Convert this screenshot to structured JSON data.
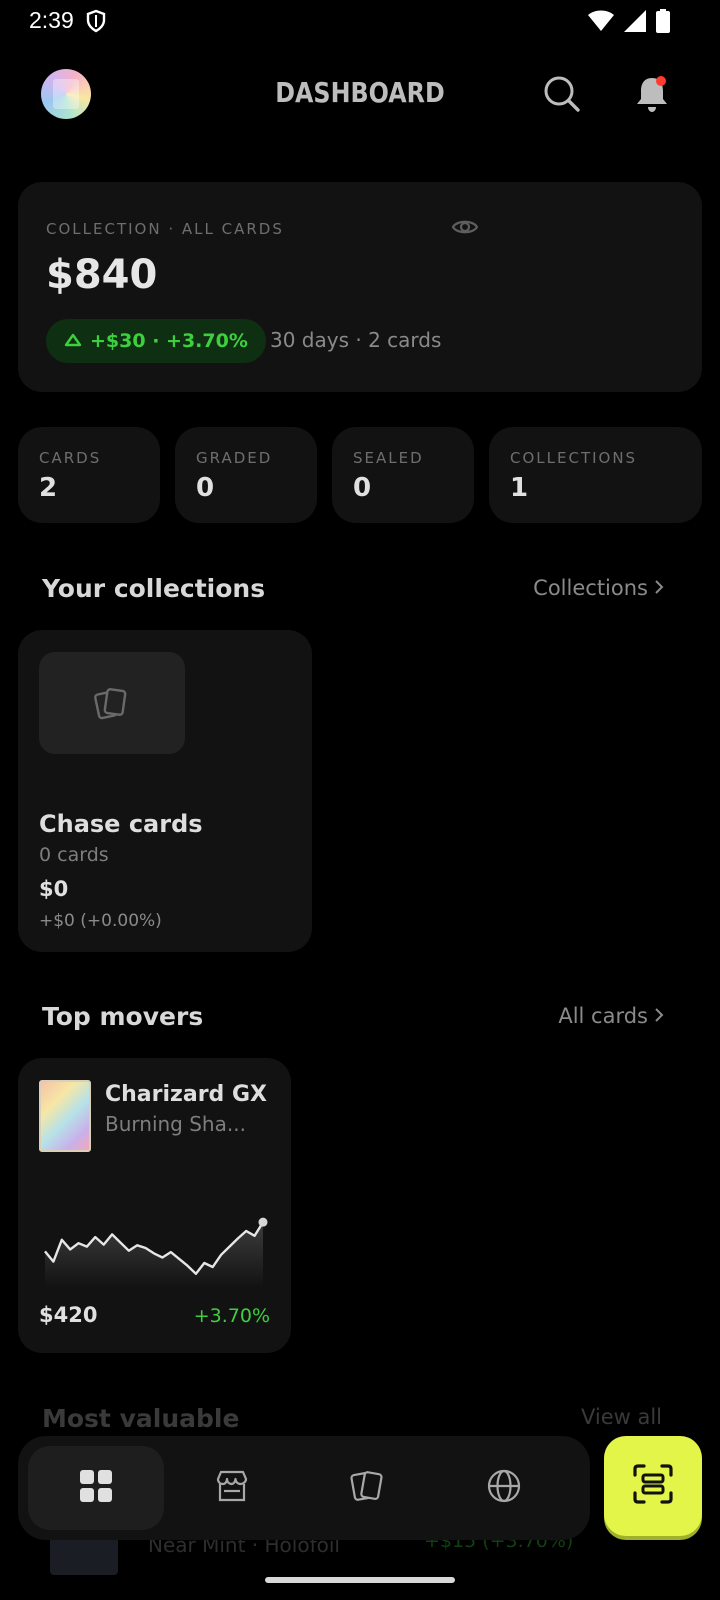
{
  "status_bar": {
    "time": "2:39"
  },
  "header": {
    "title": "DASHBOARD"
  },
  "summary": {
    "label": "COLLECTION · ALL CARDS",
    "value": "$840",
    "change": "+$30 · +3.70%",
    "meta": "30 days · 2 cards"
  },
  "stats": [
    {
      "label": "CARDS",
      "value": "2"
    },
    {
      "label": "GRADED",
      "value": "0"
    },
    {
      "label": "SEALED",
      "value": "0"
    },
    {
      "label": "COLLECTIONS",
      "value": "1"
    }
  ],
  "collections": {
    "title": "Your collections",
    "link": "Collections",
    "items": [
      {
        "name": "Chase cards",
        "count": "0 cards",
        "value": "$0",
        "change": "+$0 (+0.00%)"
      }
    ]
  },
  "top_movers": {
    "title": "Top movers",
    "link": "All cards",
    "items": [
      {
        "name": "Charizard GX",
        "set": "Burning Sha...",
        "price": "$420",
        "change": "+3.70%",
        "sparkline": [
          0.45,
          0.3,
          0.62,
          0.48,
          0.57,
          0.52,
          0.66,
          0.55,
          0.7,
          0.58,
          0.46,
          0.54,
          0.5,
          0.42,
          0.36,
          0.44,
          0.34,
          0.24,
          0.12,
          0.28,
          0.22,
          0.4,
          0.52,
          0.64,
          0.75,
          0.68,
          0.88
        ]
      }
    ]
  },
  "most_valuable": {
    "title": "Most valuable",
    "link": "View all",
    "row_text": "Near Mint · Holofoil",
    "row_change": "+$15 (+3.70%)"
  },
  "nav": {
    "items": [
      {
        "icon": "dashboard-grid-icon"
      },
      {
        "icon": "store-icon"
      },
      {
        "icon": "cards-icon"
      },
      {
        "icon": "globe-icon"
      }
    ],
    "scan_icon": "scan-icon"
  },
  "colors": {
    "accent": "#e4f54a",
    "positive": "#3ecf3e",
    "alert": "#ff3b30"
  }
}
